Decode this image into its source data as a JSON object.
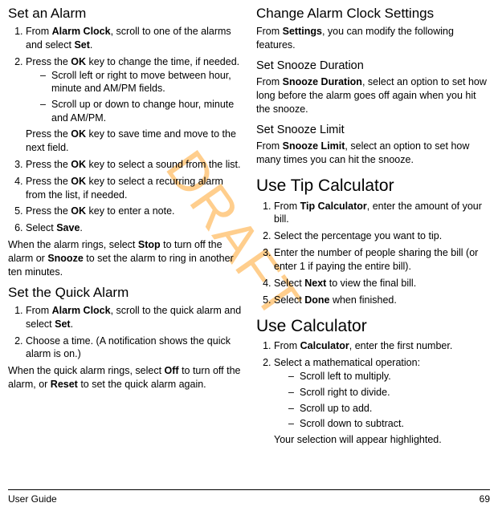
{
  "watermark": "DRAFT",
  "left": {
    "set_alarm": {
      "heading": "Set an Alarm",
      "step1_a": "From ",
      "step1_b": "Alarm Clock",
      "step1_c": ", scroll to one of the alarms and select ",
      "step1_d": "Set",
      "step1_e": ".",
      "step2_a": "Press the ",
      "step2_b": "OK",
      "step2_c": " key to change the time, if needed.",
      "step2_sub1": "Scroll left or right to move between hour, minute and AM/PM fields.",
      "step2_sub2": "Scroll up or down to change hour, minute and AM/PM.",
      "step2_extra_a": "Press the ",
      "step2_extra_b": "OK",
      "step2_extra_c": " key to save time and move to the next field.",
      "step3_a": "Press the ",
      "step3_b": "OK",
      "step3_c": " key to select a sound from the list.",
      "step4_a": "Press the ",
      "step4_b": "OK",
      "step4_c": " key to select a recurring alarm from the list, if needed.",
      "step5_a": "Press the ",
      "step5_b": "OK",
      "step5_c": " key to enter a note.",
      "step6_a": "Select ",
      "step6_b": "Save",
      "step6_c": ".",
      "after_a": "When the alarm rings, select ",
      "after_b": "Stop",
      "after_c": " to turn off the alarm or ",
      "after_d": "Snooze",
      "after_e": " to set the alarm to ring in another ten minutes."
    },
    "quick_alarm": {
      "heading": "Set the Quick Alarm",
      "step1_a": "From ",
      "step1_b": "Alarm Clock",
      "step1_c": ", scroll to the quick alarm and select ",
      "step1_d": "Set",
      "step1_e": ".",
      "step2": "Choose a time. (A notification shows the quick alarm is on.)",
      "after_a": "When the quick alarm rings, select ",
      "after_b": "Off",
      "after_c": " to turn off the alarm, or ",
      "after_d": "Reset",
      "after_e": " to set the quick alarm again."
    }
  },
  "right": {
    "change_settings": {
      "heading": "Change Alarm Clock Settings",
      "p_a": "From ",
      "p_b": "Settings",
      "p_c": ", you can modify the following features."
    },
    "snooze_duration": {
      "heading": "Set Snooze Duration",
      "p_a": "From ",
      "p_b": "Snooze Duration",
      "p_c": ", select an option to set how long before the alarm goes off again when you hit the snooze."
    },
    "snooze_limit": {
      "heading": "Set Snooze Limit",
      "p_a": "From ",
      "p_b": "Snooze Limit",
      "p_c": ", select an option to set how many times you can hit the snooze."
    },
    "tip_calc": {
      "heading": "Use Tip Calculator",
      "step1_a": "From ",
      "step1_b": "Tip Calculator",
      "step1_c": ", enter the amount of your bill.",
      "step2": "Select the percentage you want to tip.",
      "step3": "Enter the number of people sharing the bill (or enter 1 if paying the entire bill).",
      "step4_a": "Select ",
      "step4_b": "Next",
      "step4_c": " to view the final bill.",
      "step5_a": "Select ",
      "step5_b": "Done",
      "step5_c": " when finished."
    },
    "calculator": {
      "heading": "Use Calculator",
      "step1_a": "From ",
      "step1_b": "Calculator",
      "step1_c": ", enter the first number.",
      "step2_intro": "Select a mathematical operation:",
      "step2_sub1": "Scroll left to multiply.",
      "step2_sub2": "Scroll right to divide.",
      "step2_sub3": "Scroll up to add.",
      "step2_sub4": "Scroll down to subtract.",
      "step2_extra": "Your selection will appear highlighted."
    }
  },
  "footer": {
    "left": "User Guide",
    "right": "69"
  }
}
